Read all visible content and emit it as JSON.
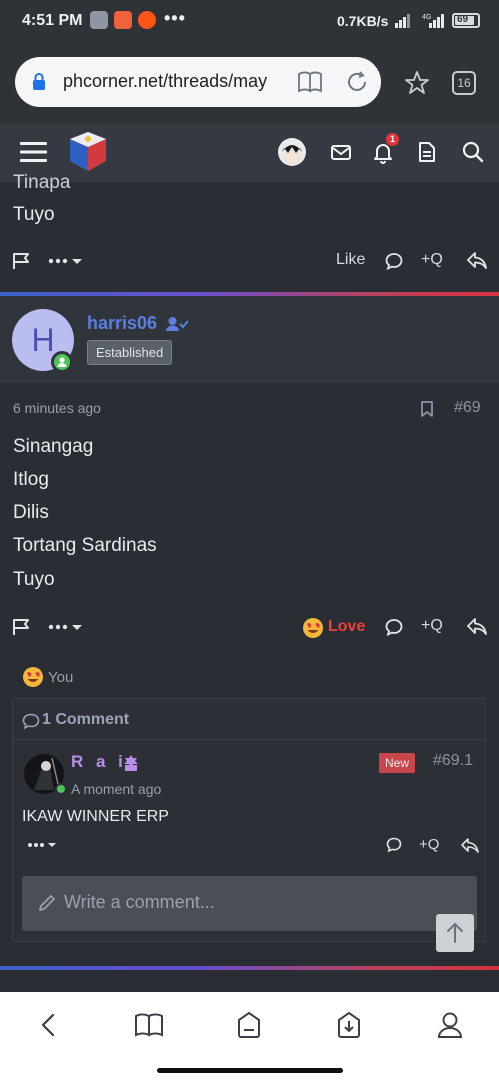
{
  "status_bar": {
    "time": "4:51 PM",
    "more": "•••",
    "net_speed": "0.7KB/s",
    "battery": "69"
  },
  "browser": {
    "url": "phcorner.net/threads/may",
    "tab_count": "16"
  },
  "header": {
    "notification_count": "1"
  },
  "previous_post": {
    "lines": [
      "Tinapa",
      "Tuyo"
    ],
    "like_label": "Like",
    "quote_label": "+Q"
  },
  "post": {
    "avatar_letter": "H",
    "username": "harris06",
    "user_title": "Established",
    "time_ago": "6 minutes ago",
    "post_number": "#69",
    "lines": [
      "Sinangag",
      "Itlog",
      "Dilis",
      "Tortang Sardinas",
      "Tuyo"
    ],
    "reaction_label": "Love",
    "quote_label": "+Q",
    "reacted_by": "You",
    "comments_header": "1 Comment"
  },
  "comment": {
    "author": "R a i",
    "badge": "New",
    "number": "#69.1",
    "time_ago": "A moment ago",
    "text": "IKAW WINNER ERP",
    "quote_label": "+Q",
    "input_placeholder": "Write a comment..."
  },
  "colors": {
    "accent_blue": "#5a7fe0",
    "love_red": "#e9423a",
    "online_green": "#4ec35a",
    "badge_red": "#c9474c"
  }
}
